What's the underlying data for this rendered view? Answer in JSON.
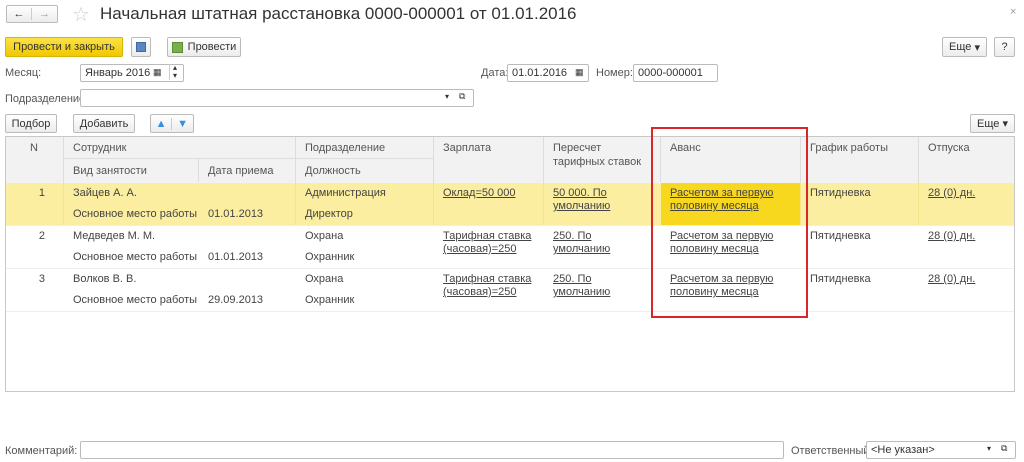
{
  "window": {
    "title": "Начальная штатная расстановка 0000-000001 от 01.01.2016",
    "close": "×"
  },
  "nav": {
    "back": "←",
    "forward": "→",
    "star": "☆"
  },
  "toolbar": {
    "post_close": "Провести и закрыть",
    "save": "💾",
    "post": "Провести",
    "more": "Еще",
    "help": "?"
  },
  "form": {
    "month_label": "Месяц:",
    "month_value": "Январь 2016",
    "date_label": "Дата:",
    "date_value": "01.01.2016",
    "number_label": "Номер:",
    "number_value": "0000-000001",
    "dept_label": "Подразделение:",
    "dept_value": ""
  },
  "table_toolbar": {
    "pick": "Подбор",
    "add": "Добавить",
    "up": "🡅",
    "down": "🡇",
    "more": "Еще"
  },
  "columns": {
    "n": "N",
    "employee": "Сотрудник",
    "employment": "Вид занятости",
    "hire_date": "Дата приема",
    "dept": "Подразделение",
    "position": "Должность",
    "salary": "Зарплата",
    "recalc": "Пересчет тарифных ставок",
    "advance": "Аванс",
    "schedule": "График работы",
    "vacation": "Отпуска"
  },
  "rows": [
    {
      "n": "1",
      "employee": "Зайцев А. А.",
      "employment": "Основное место работы",
      "hire_date": "01.01.2013",
      "dept": "Администрация",
      "position": "Директор",
      "salary": "Оклад=50 000",
      "recalc": "50 000. По умолчанию",
      "advance": "Расчетом за первую половину месяца",
      "schedule": "Пятидневка",
      "vacation": "28 (0) дн."
    },
    {
      "n": "2",
      "employee": "Медведев М. М.",
      "employment": "Основное место работы",
      "hire_date": "01.01.2013",
      "dept": "Охрана",
      "position": "Охранник",
      "salary": "Тарифная ставка (часовая)=250",
      "recalc": "250. По умолчанию",
      "advance": "Расчетом за первую половину месяца",
      "schedule": "Пятидневка",
      "vacation": "28 (0) дн."
    },
    {
      "n": "3",
      "employee": "Волков В. В.",
      "employment": "Основное место работы",
      "hire_date": "29.09.2013",
      "dept": "Охрана",
      "position": "Охранник",
      "salary": "Тарифная ставка (часовая)=250",
      "recalc": "250. По умолчанию",
      "advance": "Расчетом за первую половину месяца",
      "schedule": "Пятидневка",
      "vacation": "28 (0) дн."
    }
  ],
  "footer": {
    "comment_label": "Комментарий:",
    "comment_value": "",
    "responsible_label": "Ответственный:",
    "responsible_value": "<Не указан>"
  },
  "colors": {
    "accent": "#f5d31c",
    "selected_row": "#fbeea0",
    "highlight_box": "#d9262b"
  }
}
